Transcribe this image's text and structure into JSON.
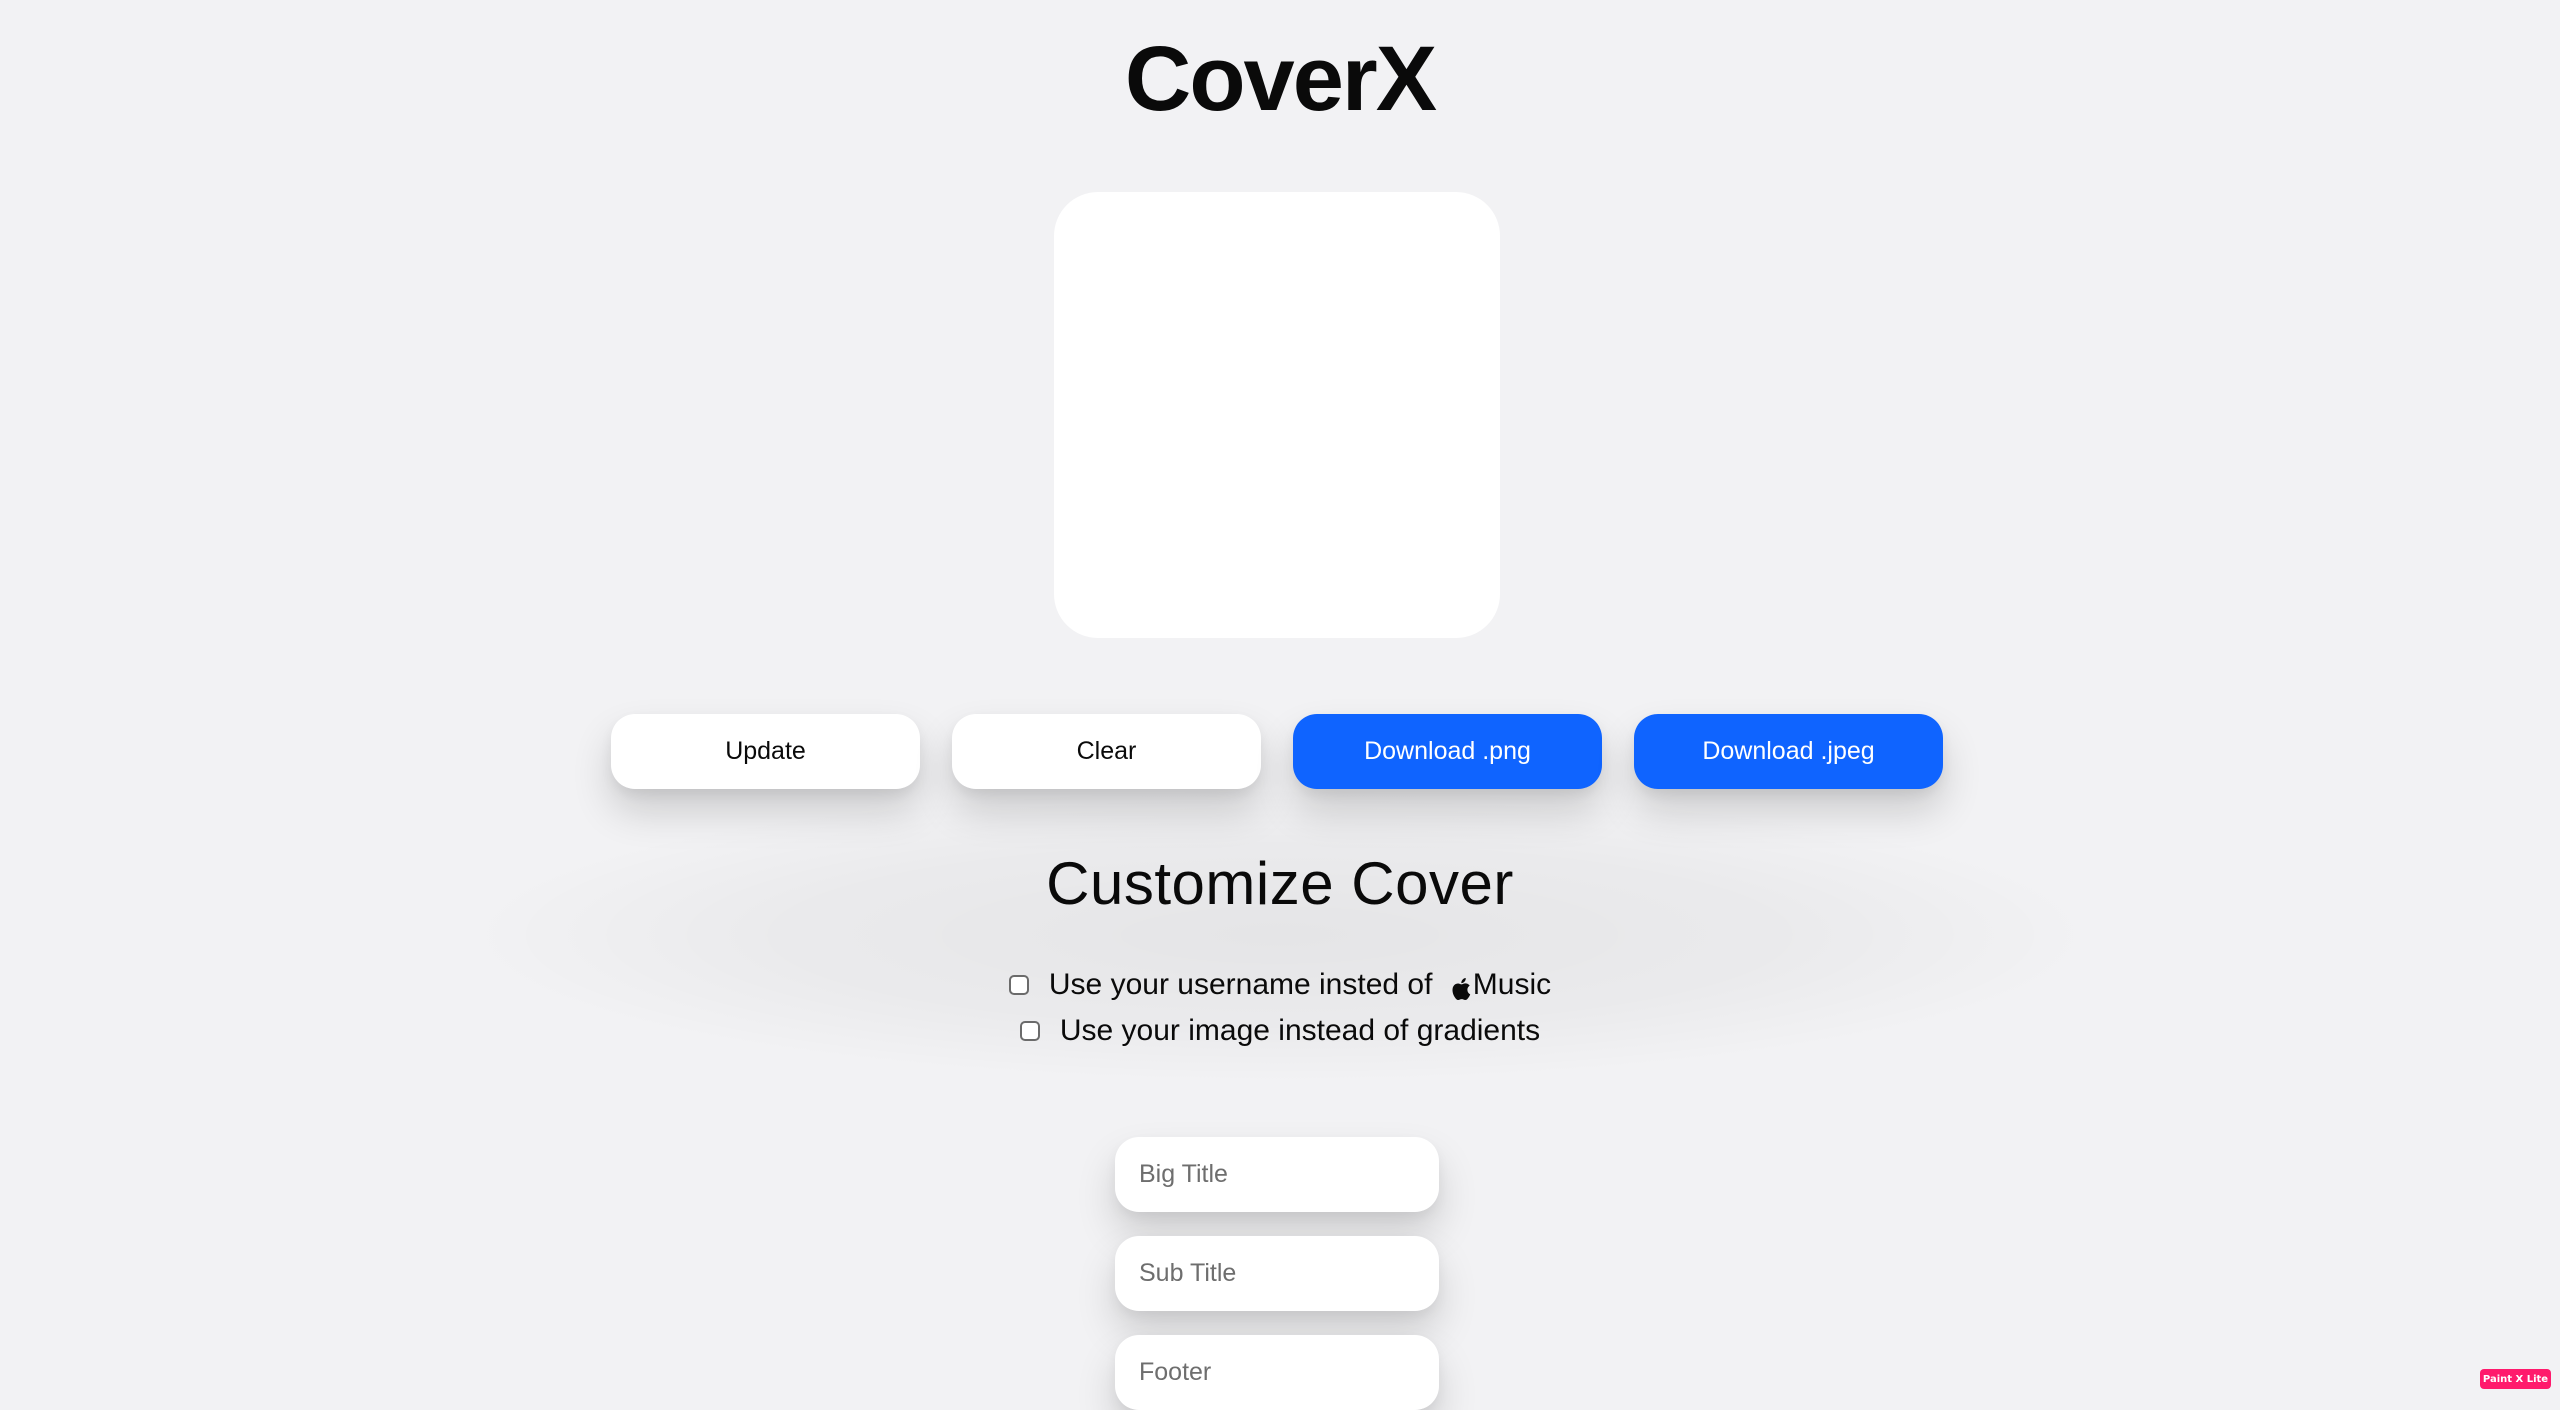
{
  "app": {
    "title": "CoverX"
  },
  "toolbar": {
    "update_label": "Update",
    "clear_label": "Clear",
    "download_png_label": "Download .png",
    "download_jpeg_label": "Download .jpeg"
  },
  "customize": {
    "title": "Customize Cover",
    "options": [
      {
        "label_prefix": "Use your username insted of ",
        "brand_icon": "apple-icon",
        "label_suffix": "Music",
        "checked": false
      },
      {
        "label": "Use your image instead of gradients",
        "checked": false
      }
    ]
  },
  "fields": {
    "big_title": {
      "placeholder": "Big Title",
      "value": ""
    },
    "sub_title": {
      "placeholder": "Sub Title",
      "value": ""
    },
    "footer": {
      "placeholder": "Footer",
      "value": ""
    }
  },
  "badge": {
    "label": "Paint X Lite"
  },
  "colors": {
    "background": "#f2f2f4",
    "accent": "#0f64ff",
    "badge": "#ff1a6c"
  }
}
